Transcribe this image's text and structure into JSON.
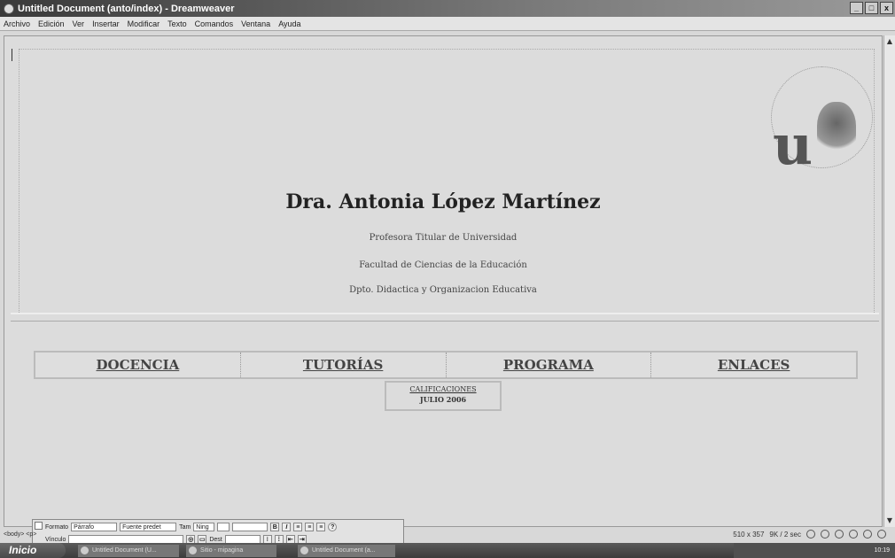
{
  "window": {
    "title": "Untitled Document (anto/index) - Dreamweaver",
    "controls": [
      "_",
      "□",
      "x"
    ]
  },
  "menu": [
    "Archivo",
    "Edición",
    "Ver",
    "Insertar",
    "Modificar",
    "Texto",
    "Comandos",
    "Ventana",
    "Ayuda"
  ],
  "page": {
    "name": "Dra. Antonia López Martínez",
    "line1": "Profesora Titular de Universidad",
    "line2": "Facultad de Ciencias de la Educación",
    "line3": "Dpto. Didactica y Organizacion Educativa",
    "logo_letter": "u",
    "nav": [
      "DOCENCIA",
      "TUTORÍAS",
      "PROGRAMA",
      "ENLACES"
    ],
    "calificaciones": "CALIFICACIONES",
    "calificaciones_sub": "JULIO 2006"
  },
  "properties": {
    "format_label": "Formato",
    "format_value": "Párrafo",
    "font_value": "Fuente predet",
    "size_label": "Tam",
    "size_value": "Ning",
    "link_label": "Vínculo",
    "target_label": "Dest",
    "bold": "B",
    "italic": "I"
  },
  "status": {
    "tag": "<body> <p>",
    "size_info": "510 x 357",
    "download": "9K / 2 sec"
  },
  "taskbar": {
    "start": "Inicio",
    "tasks": [
      "Untitled Document (U...",
      "Sitio - mipagina",
      "Untitled Document (a..."
    ],
    "clock": "10:19"
  }
}
